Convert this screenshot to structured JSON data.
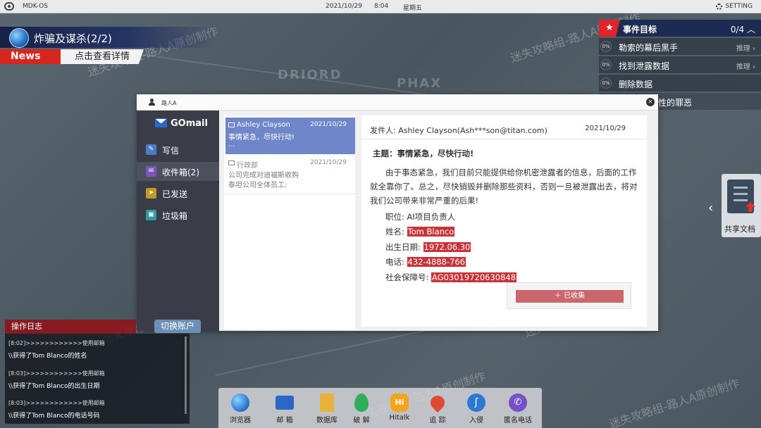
{
  "statusbar": {
    "os_name": "MDK-OS",
    "date": "2021/10/29",
    "time": "8:04",
    "weekday": "星期五",
    "setting": "SETTING"
  },
  "news": {
    "title": "炸骗及谋杀(2/2)",
    "tag": "News",
    "detail": "点击查看详情"
  },
  "map_regions": [
    "DRIORD",
    "PHAX"
  ],
  "events": {
    "title": "事件目标",
    "count": "0/4",
    "items": [
      {
        "pct": "0%",
        "label": "勒索的幕后黑手",
        "hint": "推理"
      },
      {
        "pct": "0%",
        "label": "找到泄露数据",
        "hint": "推理"
      },
      {
        "pct": "0%",
        "label": "删除数据",
        "hint": ""
      },
      {
        "pct": "",
        "label": "性的罪恶",
        "hint": ""
      }
    ]
  },
  "share_doc": {
    "label": "共享文档"
  },
  "window": {
    "user": "路人A",
    "app_name": "GOmail",
    "nav": [
      {
        "label": "写信",
        "icon": "✎",
        "color": "#4a7cc7"
      },
      {
        "label": "收件箱(2)",
        "icon": "✉",
        "color": "#7a56b8"
      },
      {
        "label": "已发送",
        "icon": "➤",
        "color": "#c49a22"
      },
      {
        "label": "垃圾箱",
        "icon": "🗑",
        "color": "#2f9aa0"
      }
    ],
    "switch_account": "切换账户",
    "mails": [
      {
        "sender": "Ashley Clayson",
        "date": "2021/10/29",
        "subject": "事情紧急，尽快行动!",
        "preview": "..."
      },
      {
        "sender": "行政部",
        "date": "2021/10/29",
        "subject": "公司完成对迪福斯收购",
        "preview": "泰坦公司全体员工:"
      }
    ],
    "reader": {
      "from": "发件人:  Ashley Clayson(Ash***son@titan.com)",
      "date": "2021/10/29",
      "subject": "主题：事情紧急，尽快行动!",
      "body": "由于事态紧急，我们目前只能提供给你机密泄露者的信息，后面的工作就全靠你了。总之，尽快销毁并删除那些资料，否则一旦被泄露出去，将对我们公司带来非常严重的后果!",
      "fields": [
        {
          "label": "职位:",
          "value": "AI项目负责人",
          "highlight": false
        },
        {
          "label": "姓名:",
          "value": "Tom Blanco",
          "highlight": true
        },
        {
          "label": "出生日期:",
          "value": "1972.06.30",
          "highlight": true
        },
        {
          "label": "电话:",
          "value": "432-4888-766",
          "highlight": true
        },
        {
          "label": "社会保障号:",
          "value": "AG03019720630848",
          "highlight": true
        }
      ],
      "collected": "已收集"
    }
  },
  "log": {
    "title": "操作日志",
    "entries": [
      {
        "l1": "[8:02]>>>>>>>>>>>>使用邮箱",
        "l2": "\\\\获得了Tom Blanco的姓名"
      },
      {
        "l1": "[8:03]>>>>>>>>>>>>使用邮箱",
        "l2": "\\\\获得了Tom Blanco的出生日期"
      },
      {
        "l1": "[8:03]>>>>>>>>>>>>使用邮箱",
        "l2": "\\\\获得了Tom Blanco的电话号码"
      }
    ]
  },
  "dock": [
    {
      "label": "浏览器",
      "color": "#2c7fd6"
    },
    {
      "label": "邮 箱",
      "color": "#2c67c7"
    },
    {
      "label": "数据库",
      "color": "#e6b23a"
    },
    {
      "label": "破 解",
      "color": "#2fae5c"
    },
    {
      "label": "Hitalk",
      "color": "#f2a51c"
    },
    {
      "label": "追 踪",
      "color": "#e04a35"
    },
    {
      "label": "入侵",
      "color": "#2f78d2"
    },
    {
      "label": "匿名电话",
      "color": "#7650c8"
    }
  ],
  "watermark": "迷失攻略组-路人A原创制作"
}
